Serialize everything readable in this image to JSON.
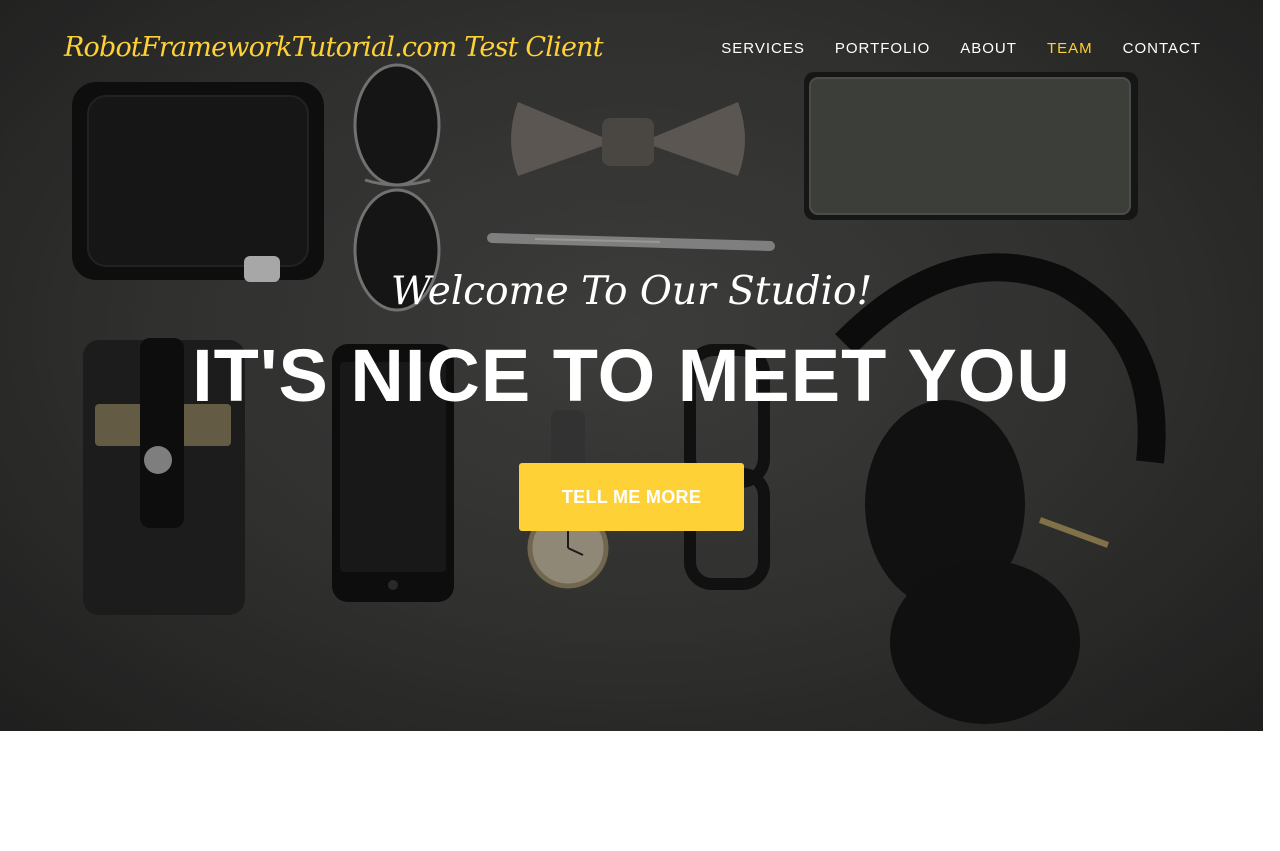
{
  "navbar": {
    "brand": "RobotFrameworkTutorial.com Test Client",
    "items": [
      {
        "label": "SERVICES",
        "active": false
      },
      {
        "label": "PORTFOLIO",
        "active": false
      },
      {
        "label": "ABOUT",
        "active": false
      },
      {
        "label": "TEAM",
        "active": true
      },
      {
        "label": "CONTACT",
        "active": false
      }
    ]
  },
  "hero": {
    "lead_in": "Welcome To Our Studio!",
    "heading": "IT'S NICE TO MEET YOU",
    "cta_label": "TELL ME MORE"
  },
  "colors": {
    "accent": "#fed136",
    "hero_background": "#3a3a38",
    "nav_text": "#ffffff",
    "page_background": "#ffffff"
  },
  "icons": [
    "wallet",
    "sunglasses",
    "bow-tie",
    "pen",
    "notebook",
    "card-holder",
    "smartphone",
    "watch",
    "eyeglasses",
    "headphones"
  ]
}
